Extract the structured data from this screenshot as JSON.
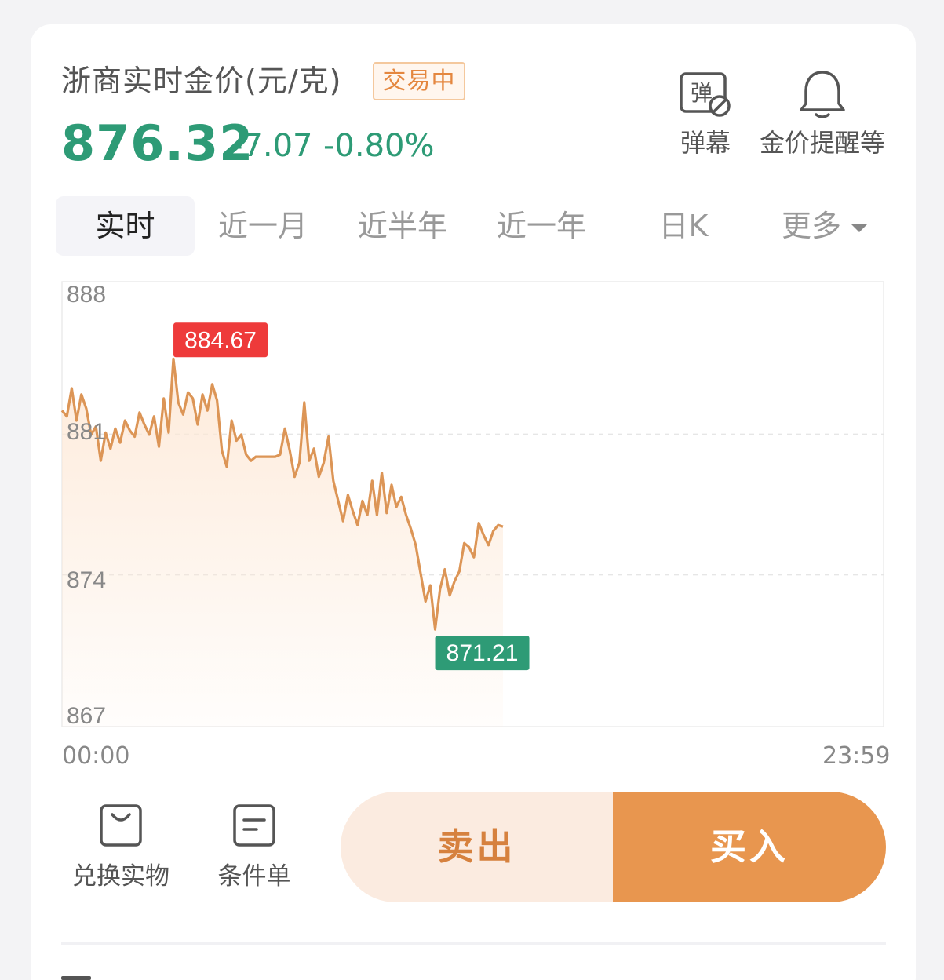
{
  "header": {
    "title": "浙商实时金价(元/克)",
    "status_badge": "交易中",
    "price": "876.32",
    "change": "-7.07",
    "change_pct": "-0.80%"
  },
  "tools": {
    "danmu_label": "弹幕",
    "danmu_icon_char": "弹",
    "alert_label": "金价提醒等"
  },
  "tabs": [
    "实时",
    "近一月",
    "近半年",
    "近一年",
    "日K",
    "更多"
  ],
  "chart_data": {
    "type": "line",
    "xlabel": "",
    "ylabel": "",
    "ylim": [
      867,
      888
    ],
    "y_ticks": [
      "888",
      "881",
      "874",
      "867"
    ],
    "x_range": [
      "00:00",
      "23:59"
    ],
    "x_ticks": [
      "00:00",
      "23:59"
    ],
    "series": [
      {
        "values": [
          882.1,
          881.8,
          883.2,
          881.6,
          882.9,
          882.2,
          880.9,
          881.3,
          879.6,
          881.0,
          880.2,
          881.2,
          880.5,
          881.6,
          881.1,
          880.8,
          882.0,
          881.4,
          880.9,
          881.8,
          880.3,
          882.7,
          881.0,
          884.67,
          882.5,
          881.9,
          883.0,
          882.7,
          881.4,
          882.9,
          882.1,
          883.4,
          882.6,
          880.1,
          879.3,
          881.6,
          880.6,
          880.9,
          879.9,
          879.6,
          879.8,
          879.8,
          879.8,
          879.8,
          879.8,
          879.9,
          881.2,
          880.1,
          878.8,
          879.5,
          882.5,
          879.6,
          880.2,
          878.8,
          879.5,
          880.8,
          878.6,
          877.6,
          876.6,
          877.9,
          877.1,
          876.4,
          877.6,
          876.9,
          878.6,
          876.9,
          879.0,
          877.0,
          878.4,
          877.3,
          877.8,
          876.9,
          876.2,
          875.4,
          874.0,
          872.6,
          873.4,
          871.21,
          873.2,
          874.2,
          872.9,
          873.6,
          874.1,
          875.5,
          875.3,
          874.8,
          876.5,
          875.9,
          875.4,
          876.1,
          876.4,
          876.32
        ]
      }
    ],
    "annotations": [
      {
        "label": "884.67",
        "value": 884.67,
        "kind": "high",
        "color": "#ee3a3a"
      },
      {
        "label": "871.21",
        "value": 871.21,
        "kind": "low",
        "color": "#2e9b76"
      }
    ],
    "line_color": "#dc9556",
    "fill_color": "#fde7d4",
    "grid": true
  },
  "actions": {
    "exchange_label": "兑换实物",
    "condition_label": "条件单",
    "sell_label": "卖出",
    "buy_label": "买入"
  },
  "colors": {
    "down": "#2e9b76",
    "up": "#ee3a3a",
    "accent": "#e8964f"
  }
}
